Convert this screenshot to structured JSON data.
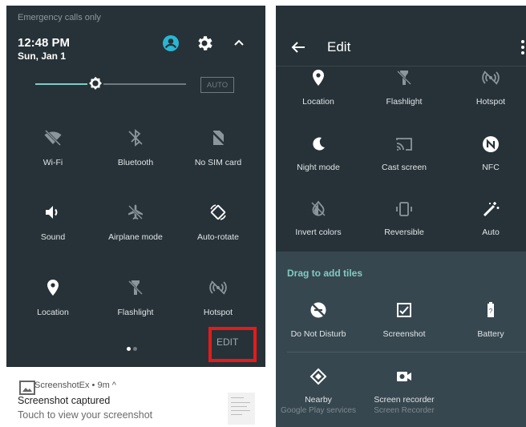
{
  "quick_settings": {
    "status_text": "Emergency calls only",
    "time": "12:48 PM",
    "date": "Sun, Jan 1",
    "brightness_level": 0.4,
    "auto_label": "AUTO",
    "tiles": [
      {
        "label": "Wi-Fi",
        "icon": "wifi-off-icon"
      },
      {
        "label": "Bluetooth",
        "icon": "bluetooth-off-icon"
      },
      {
        "label": "No SIM card",
        "icon": "no-sim-icon"
      },
      {
        "label": "Sound",
        "icon": "volume-icon"
      },
      {
        "label": "Airplane mode",
        "icon": "airplane-off-icon"
      },
      {
        "label": "Auto-rotate",
        "icon": "auto-rotate-icon"
      },
      {
        "label": "Location",
        "icon": "location-icon"
      },
      {
        "label": "Flashlight",
        "icon": "flashlight-off-icon"
      },
      {
        "label": "Hotspot",
        "icon": "hotspot-off-icon"
      }
    ],
    "edit_label": "EDIT"
  },
  "notification": {
    "app": "ScreenshotEx • 9m ^",
    "title": "Screenshot captured",
    "body": "Touch to view your screenshot"
  },
  "edit_screen": {
    "title": "Edit",
    "added_tiles": [
      {
        "label": "Location",
        "icon": "location-icon"
      },
      {
        "label": "Flashlight",
        "icon": "flashlight-off-icon"
      },
      {
        "label": "Hotspot",
        "icon": "hotspot-off-icon"
      },
      {
        "label": "Night mode",
        "icon": "night-mode-icon"
      },
      {
        "label": "Cast screen",
        "icon": "cast-icon"
      },
      {
        "label": "NFC",
        "icon": "nfc-icon"
      },
      {
        "label": "Invert colors",
        "icon": "invert-colors-icon"
      },
      {
        "label": "Reversible",
        "icon": "reversible-icon"
      },
      {
        "label": "Auto",
        "icon": "auto-magic-icon"
      }
    ],
    "drag_title": "Drag to add tiles",
    "available_tiles": [
      {
        "label": "Do Not Disturb",
        "icon": "dnd-off-icon"
      },
      {
        "label": "Screenshot",
        "icon": "screenshot-icon"
      },
      {
        "label": "Battery",
        "icon": "battery-icon"
      },
      {
        "label": "Nearby",
        "sublabel": "Google Play services",
        "icon": "nearby-icon"
      },
      {
        "label": "Screen recorder",
        "sublabel": "Screen Recorder",
        "icon": "screen-recorder-icon"
      }
    ]
  },
  "colors": {
    "panel_bg": "#263238",
    "accent": "#80cbc4",
    "highlight_box": "#e51a1a"
  }
}
